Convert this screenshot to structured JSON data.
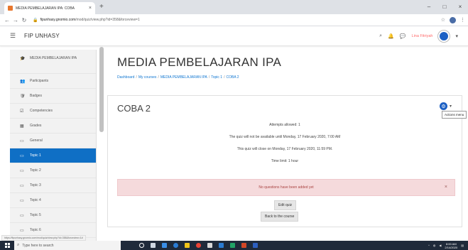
{
  "browser": {
    "tab_title": "MEDIA PEMBELAJARAN IPA: COBA",
    "tab_close": "×",
    "new_tab": "+",
    "url_host": "fipunhasy.gnomio.com",
    "url_path": "/mod/quiz/view.php?id=358&forceview=1",
    "window_controls": [
      "–",
      "□",
      "×"
    ]
  },
  "navbar": {
    "site_name": "FIP UNHASY",
    "user_name": "Lina Fitriyah"
  },
  "drawer": {
    "items": [
      {
        "label": "MEDIA PEMBELAJARAN IPA",
        "icon": "mortarboard-icon",
        "glyph": "🎓"
      },
      {
        "label": "Participants",
        "icon": "users-icon",
        "glyph": "👥"
      },
      {
        "label": "Badges",
        "icon": "badge-icon",
        "glyph": "🛡"
      },
      {
        "label": "Competencies",
        "icon": "competencies-icon",
        "glyph": "☑"
      },
      {
        "label": "Grades",
        "icon": "grades-icon",
        "glyph": "▦"
      },
      {
        "label": "General",
        "icon": "folder-icon",
        "glyph": "▭"
      },
      {
        "label": "Topic 1",
        "icon": "folder-icon",
        "glyph": "▭",
        "active": true
      },
      {
        "label": "Topic 2",
        "icon": "folder-icon",
        "glyph": "▭"
      },
      {
        "label": "Topic 3",
        "icon": "folder-icon",
        "glyph": "▭"
      },
      {
        "label": "Topic 4",
        "icon": "folder-icon",
        "glyph": "▭"
      },
      {
        "label": "Topic 5",
        "icon": "folder-icon",
        "glyph": "▭"
      },
      {
        "label": "Topic 6",
        "icon": "folder-icon",
        "glyph": "▭"
      }
    ]
  },
  "page": {
    "title": "MEDIA PEMBELAJARAN IPA",
    "breadcrumb": [
      "Dashboard",
      "My courses",
      "MEDIA PEMBELAJARAN IPA",
      "Topic 1",
      "COBA 2"
    ],
    "breadcrumb_sep": "/"
  },
  "quiz": {
    "title": "COBA 2",
    "actions_tooltip": "Actions menu",
    "attempts": "Attempts allowed: 1",
    "open_note": "The quiz will not be available until Monday, 17 February 2020, 7:00 AM",
    "close_note": "This quiz will close on Monday, 17 February 2020, 11:59 PM.",
    "time_limit": "Time limit: 1 hour",
    "alert": "No questions have been added yet",
    "alert_close": "×",
    "edit_button": "Edit quiz",
    "back_button": "Back to the course"
  },
  "status_url": "https://fipunhasy.gnomio.com/mod/quiz/view.php?id=358&forceview=1#",
  "taskbar": {
    "search_placeholder": "Type here to search",
    "time": "8:00 AM",
    "date": "2/14/2020"
  }
}
